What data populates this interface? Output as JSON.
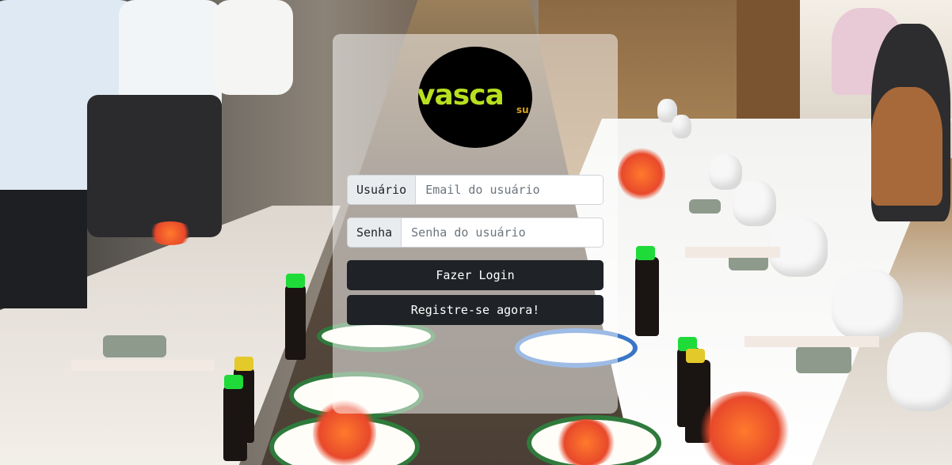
{
  "login": {
    "logo": {
      "wordmark": "vasca",
      "sub": "su",
      "colors": {
        "background": "#000000",
        "wordmark": "#b8e01f",
        "sub": "#d6a21c"
      }
    },
    "username": {
      "label": "Usuário",
      "placeholder": "Email do usuário",
      "value": ""
    },
    "password": {
      "label": "Senha",
      "placeholder": "Senha do usuário",
      "value": ""
    },
    "login_button": "Fazer Login",
    "register_button": "Registre-se agora!"
  },
  "colors": {
    "button": "#1f2227",
    "card_overlay": "rgba(255,255,255,0.5)",
    "addon_background": "#e9ecef"
  },
  "background": {
    "description_icon": "restaurant-photo"
  }
}
